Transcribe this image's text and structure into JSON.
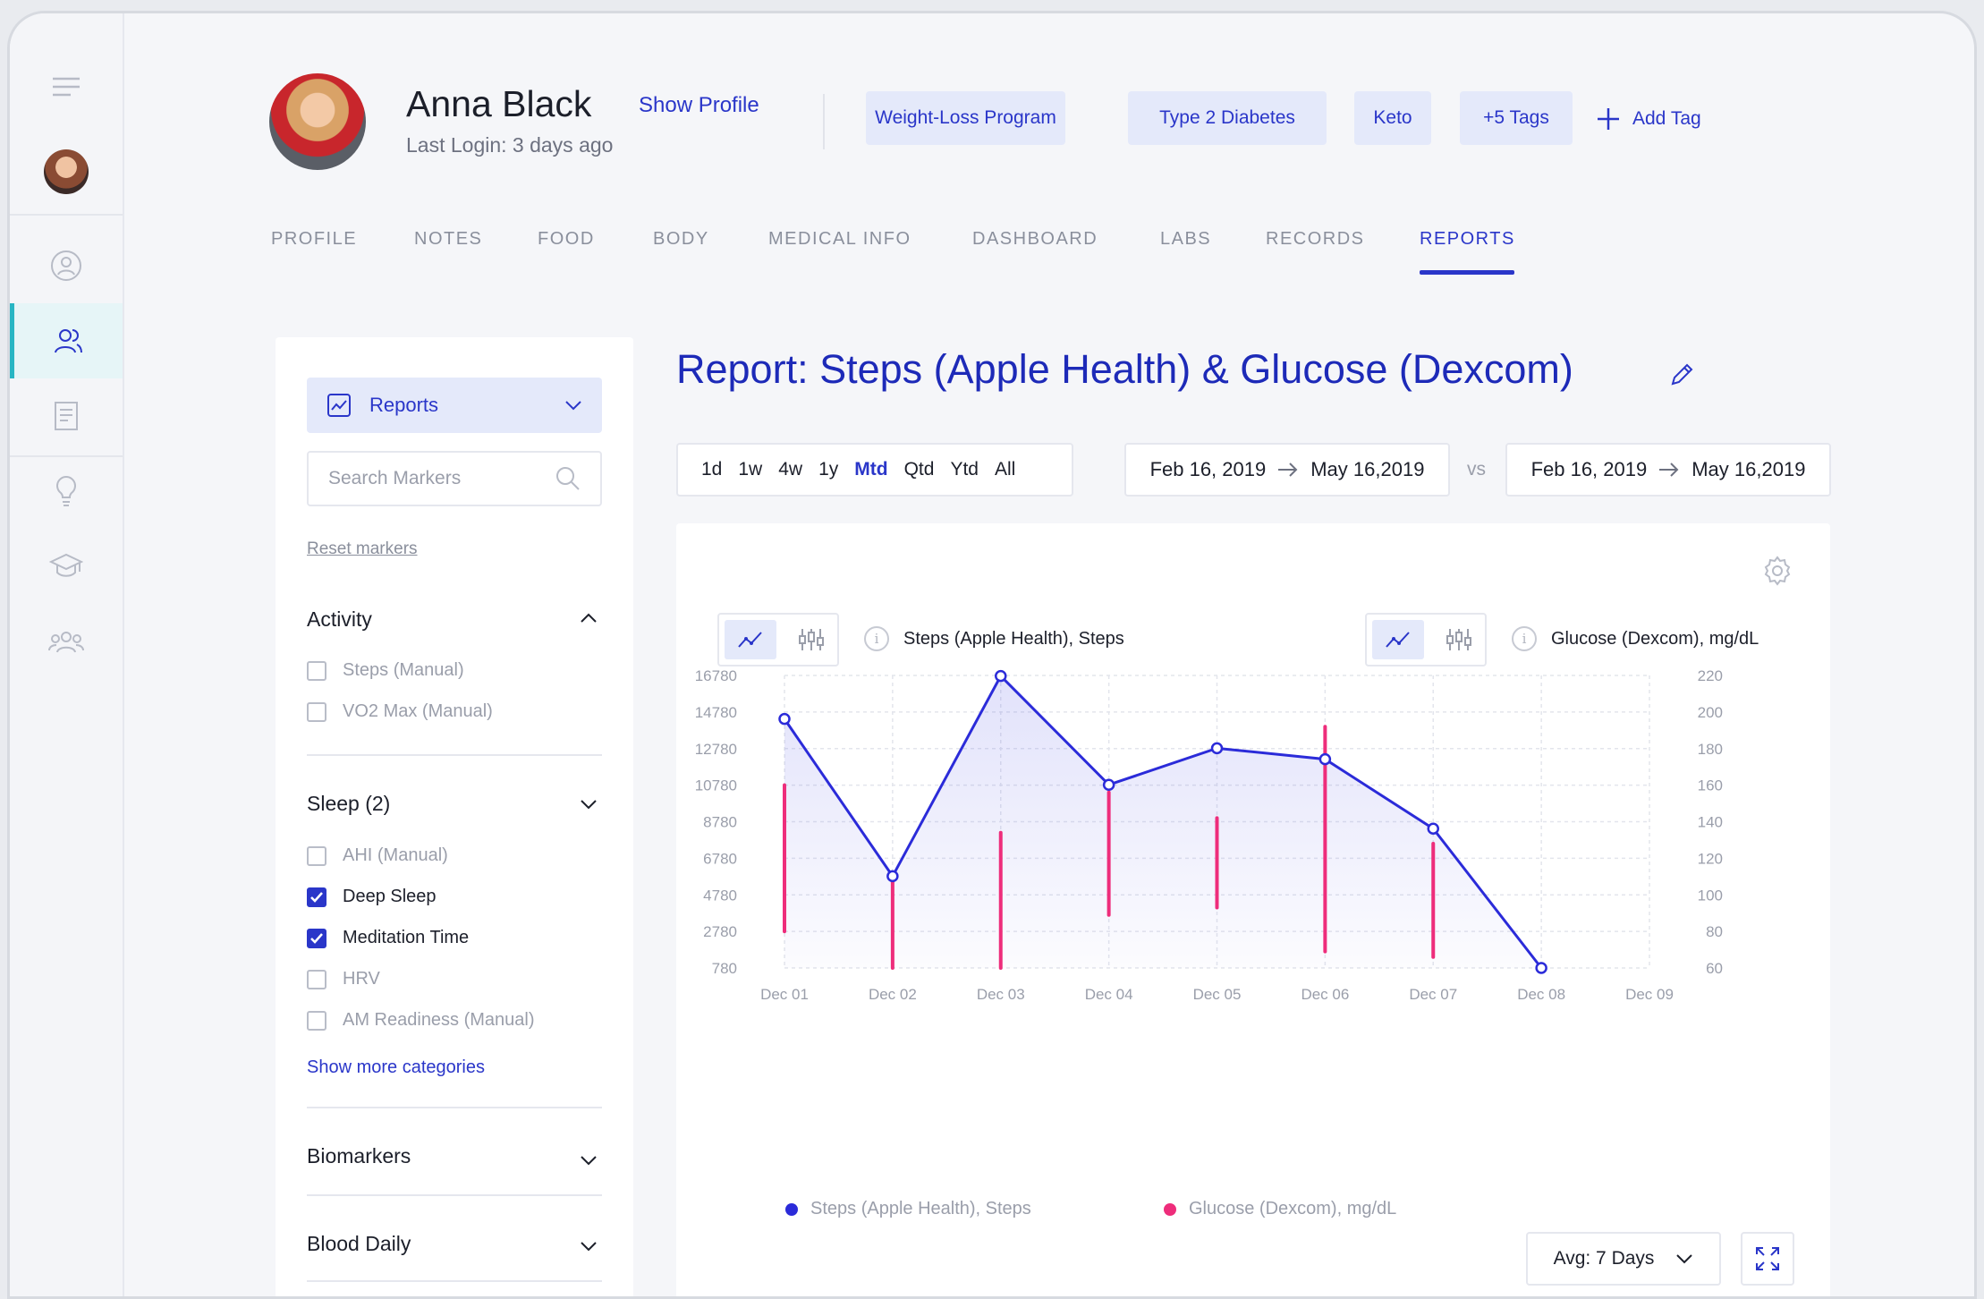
{
  "header": {
    "name": "Anna Black",
    "last_login": "Last Login: 3 days ago",
    "show_profile": "Show Profile",
    "tags": [
      "Weight-Loss Program",
      "Type 2 Diabetes",
      "Keto",
      "+5 Tags"
    ],
    "add_tag": "Add Tag"
  },
  "tabs": [
    "PROFILE",
    "NOTES",
    "FOOD",
    "BODY",
    "MEDICAL INFO",
    "DASHBOARD",
    "LABS",
    "RECORDS",
    "REPORTS"
  ],
  "active_tab": "REPORTS",
  "sidebar": {
    "dropdown": "Reports",
    "search_placeholder": "Search Markers",
    "reset": "Reset markers",
    "sections": {
      "activity": {
        "title": "Activity",
        "items": [
          {
            "label": "Steps (Manual)",
            "checked": false
          },
          {
            "label": "VO2 Max (Manual)",
            "checked": false
          }
        ]
      },
      "sleep": {
        "title": "Sleep (2)",
        "items": [
          {
            "label": "AHI (Manual)",
            "checked": false
          },
          {
            "label": "Deep Sleep",
            "checked": true
          },
          {
            "label": "Meditation Time",
            "checked": true
          },
          {
            "label": "HRV",
            "checked": false
          },
          {
            "label": "AM Readiness (Manual)",
            "checked": false
          }
        ]
      },
      "show_more": "Show more categories",
      "biomarkers": {
        "title": "Biomarkers"
      },
      "blood_daily": {
        "title": "Blood Daily"
      }
    }
  },
  "report": {
    "title": "Report: Steps (Apple Health) & Glucose (Dexcom)",
    "ranges": [
      "1d",
      "1w",
      "4w",
      "1y",
      "Mtd",
      "Qtd",
      "Ytd",
      "All"
    ],
    "active_range": "Mtd",
    "date_a_from": "Feb 16, 2019",
    "date_a_to": "May 16,2019",
    "vs": "vs",
    "date_b_from": "Feb 16, 2019",
    "date_b_to": "May 16,2019",
    "left_series_label": "Steps  (Apple Health), Steps",
    "right_series_label": "Glucose (Dexcom), mg/dL",
    "avg": "Avg: 7 Days"
  },
  "colors": {
    "accent": "#2a36c9",
    "steps": "#2b2bd9",
    "glucose": "#ee2d7b",
    "teal": "#28b5c3"
  },
  "chart_data": {
    "type": "line",
    "x": [
      "Dec 01",
      "Dec 02",
      "Dec 03",
      "Dec 04",
      "Dec 05",
      "Dec 06",
      "Dec 07",
      "Dec 08",
      "Dec 09"
    ],
    "y_left_ticks": [
      "16780",
      "14780",
      "12780",
      "10780",
      "8780",
      "6780",
      "4780",
      "2780",
      "780"
    ],
    "y_right_ticks": [
      "220",
      "200",
      "180",
      "160",
      "140",
      "120",
      "100",
      "80",
      "60"
    ],
    "ylim_left": [
      780,
      16780
    ],
    "ylim_right": [
      60,
      220
    ],
    "grid": true,
    "series": [
      {
        "name": "Steps  (Apple Health), Steps",
        "axis": "left",
        "style": "line-area",
        "values": [
          14400,
          5800,
          16750,
          10800,
          12800,
          12200,
          8400,
          780
        ]
      },
      {
        "name": "Glucose (Dexcom), mg/dL",
        "axis": "right",
        "style": "range-bar",
        "ranges": [
          [
            80,
            160
          ],
          [
            60,
            108
          ],
          [
            60,
            134
          ],
          [
            89,
            156
          ],
          [
            93,
            142
          ],
          [
            69,
            192
          ],
          [
            66,
            128
          ]
        ],
        "x_index": [
          0,
          1,
          2,
          3,
          4,
          5,
          6
        ]
      }
    ]
  }
}
